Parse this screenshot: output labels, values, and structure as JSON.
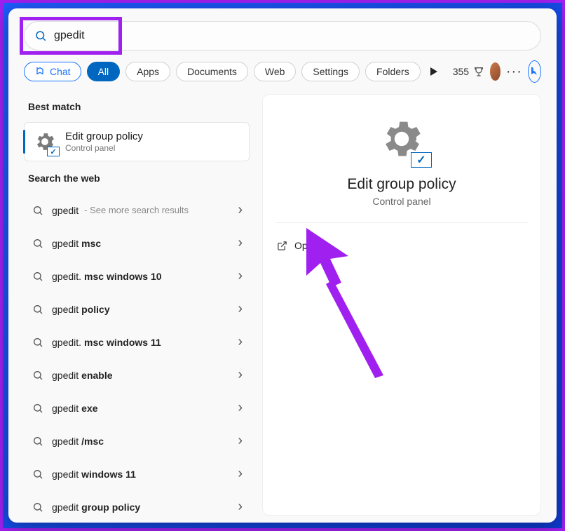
{
  "search": {
    "value": "gpedit"
  },
  "tabs": {
    "chat": "Chat",
    "items": [
      "All",
      "Apps",
      "Documents",
      "Web",
      "Settings",
      "Folders"
    ]
  },
  "rewards": {
    "points": "355"
  },
  "leftPanel": {
    "bestMatchLabel": "Best match",
    "bestMatch": {
      "title": "Edit group policy",
      "subtitle": "Control panel"
    },
    "webLabel": "Search the web",
    "webResults": [
      {
        "stem": "gpedit",
        "suffix": "",
        "hint": " - See more search results"
      },
      {
        "stem": "gpedit ",
        "suffix": "msc",
        "hint": ""
      },
      {
        "stem": "gpedit.",
        "suffix": "msc windows 10",
        "hint": ""
      },
      {
        "stem": "gpedit ",
        "suffix": "policy",
        "hint": ""
      },
      {
        "stem": "gpedit.",
        "suffix": "msc windows 11",
        "hint": ""
      },
      {
        "stem": "gpedit ",
        "suffix": "enable",
        "hint": ""
      },
      {
        "stem": "gpedit ",
        "suffix": "exe",
        "hint": ""
      },
      {
        "stem": "gpedit",
        "suffix": "/msc",
        "hint": ""
      },
      {
        "stem": "gpedit ",
        "suffix": "windows 11",
        "hint": ""
      },
      {
        "stem": "gpedit ",
        "suffix": "group policy",
        "hint": ""
      }
    ]
  },
  "detail": {
    "title": "Edit group policy",
    "subtitle": "Control panel",
    "actions": {
      "open": "Open"
    }
  }
}
